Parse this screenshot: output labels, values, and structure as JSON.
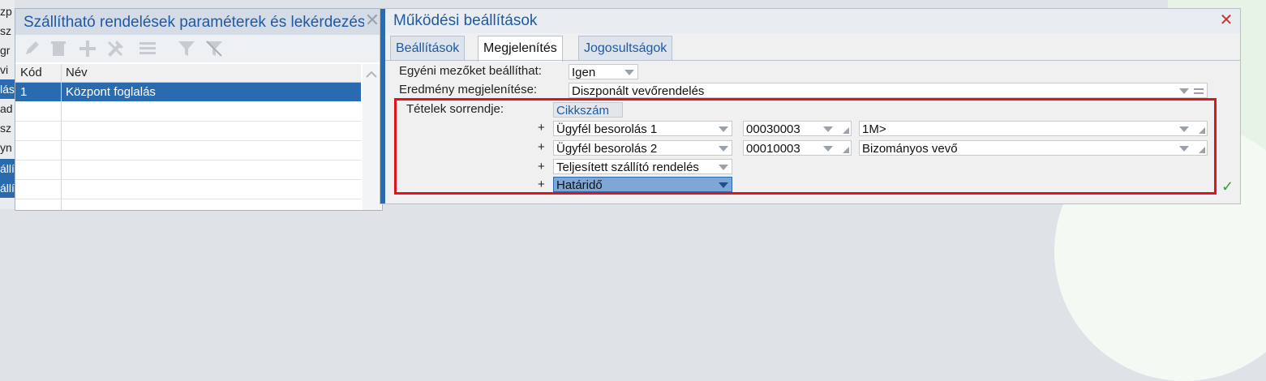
{
  "left_strip": {
    "items": [
      {
        "text": "zp",
        "selected": false
      },
      {
        "text": "sz",
        "selected": false
      },
      {
        "text": "gr",
        "selected": false
      },
      {
        "text": "vi",
        "selected": false
      },
      {
        "text": "lás",
        "selected": true
      },
      {
        "text": "ad",
        "selected": false
      },
      {
        "text": "sz",
        "selected": false
      },
      {
        "text": "yn",
        "selected": false
      },
      {
        "text": "állí",
        "selected": true
      },
      {
        "text": "állí",
        "selected": true
      }
    ]
  },
  "window1": {
    "title": "Szállítható rendelések paraméterek és lekérdezések",
    "close_label": "✕",
    "toolbar": [
      "edit-icon",
      "delete-icon",
      "add-icon",
      "tools-icon",
      "list-icon",
      "filter-icon",
      "filter-clear-icon"
    ],
    "grid": {
      "columns": [
        "Kód",
        "Név"
      ],
      "rows": [
        [
          "1",
          "Központ foglalás"
        ]
      ]
    }
  },
  "dialog": {
    "title": "Működési beállítások",
    "close_label": "✕",
    "tabs": [
      {
        "label": "Beállítások",
        "active": false
      },
      {
        "label": "Megjelenítés",
        "active": true
      },
      {
        "label": "Jogosultságok",
        "active": false
      }
    ],
    "fields": {
      "custom_fields_label": "Egyéni mezőket beállíthat:",
      "custom_fields_value": "Igen",
      "result_display_label": "Eredmény megjelenítése:",
      "result_display_value": "Diszponált vevőrendelés",
      "order_label": "Tételek sorrendje:",
      "order_first": "Cikkszám"
    },
    "order_rows": [
      {
        "plus": "+",
        "field": "Ügyfél besorolás 1",
        "code": "00030003",
        "value": "1M>"
      },
      {
        "plus": "+",
        "field": "Ügyfél besorolás 2",
        "code": "00010003",
        "value": "Bizományos vevő"
      },
      {
        "plus": "+",
        "field": "Teljesített szállító rendelés"
      },
      {
        "plus": "+",
        "field": "Határidő",
        "highlighted": true
      }
    ],
    "confirm_icon": "✓"
  }
}
